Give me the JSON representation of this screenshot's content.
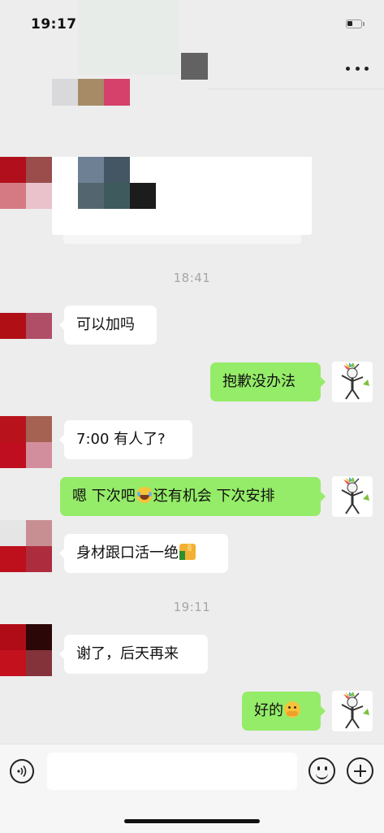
{
  "status_bar": {
    "time": "19:17"
  },
  "header": {
    "more_icon": "more-horizontal-icon"
  },
  "messages": [
    {
      "id": "msg1",
      "sender": "contact",
      "text": "可以加吗"
    },
    {
      "id": "msg2",
      "sender": "me",
      "text": "抱歉没办法"
    },
    {
      "id": "msg3",
      "sender": "contact",
      "text": "7:00 有人了?"
    },
    {
      "id": "msg4",
      "sender": "me",
      "text_a": "嗯 下次吧",
      "emoji": "laughing-tears-emoji",
      "text_b": "还有机会 下次安排"
    },
    {
      "id": "msg5",
      "sender": "contact",
      "text": "身材跟口活一绝",
      "emoji": "thumbs-up-emoji"
    },
    {
      "id": "msg6",
      "sender": "contact",
      "text": "谢了，后天再来"
    },
    {
      "id": "msg7",
      "sender": "me",
      "text": "好的",
      "emoji": "hugging-face-emoji"
    }
  ],
  "timestamps": [
    "18:41",
    "19:11"
  ],
  "input_bar": {
    "voice_icon": "voice-icon",
    "emoji_icon": "emoji-icon",
    "plus_icon": "plus-icon",
    "input_value": ""
  },
  "colors": {
    "background": "#ededed",
    "outgoing_bubble": "#95ec69",
    "incoming_bubble": "#ffffff",
    "timestamp": "#a6a6a6"
  }
}
